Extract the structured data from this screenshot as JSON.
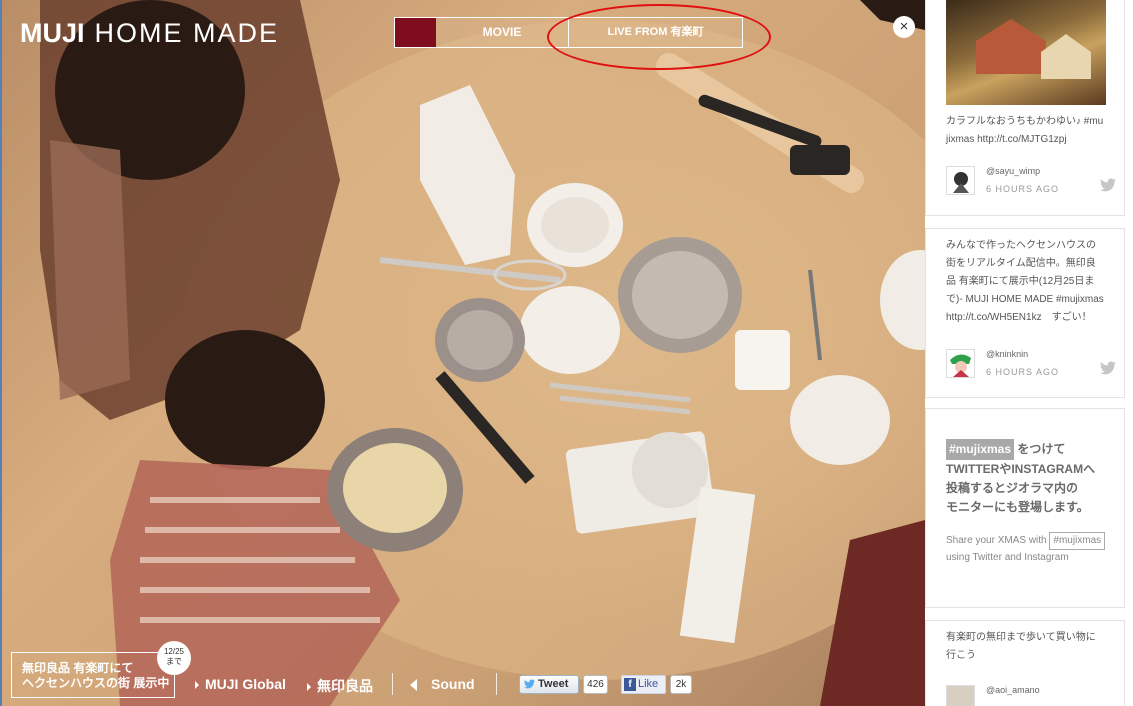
{
  "brand": {
    "logo_bold": "MUJI",
    "logo_thin": "HOME MADE"
  },
  "topnav": {
    "movie": "MOVIE",
    "live": "LIVE FROM 有楽町"
  },
  "close_label": "×",
  "sidebar": {
    "cards": [
      {
        "text": "カラフルなおうちもかわゆい♪ #mujixmas http://t.co/MJTG1zpj",
        "user": "@sayu_wimp",
        "time": "6 HOURS AGO"
      },
      {
        "text": "みんなで作ったヘクセンハウスの街をリアルタイム配信中。無印良品 有楽町にて展示中(12月25日まで)- MUJI HOME MADE #mujixmas http://t.co/WH5EN1kz　すごい！",
        "user": "@kninknin",
        "time": "6 HOURS AGO"
      },
      {
        "text": "有楽町の無印まで歩いて買い物に行こう",
        "user": "@aoi_amano",
        "time": ""
      }
    ],
    "promo": {
      "tag": "#mujixmas",
      "tag_suffix": "をつけて",
      "line2": "TWITTERやINSTAGRAMへ",
      "line3": "投稿するとジオラマ内の",
      "line4": "モニターにも登場します。",
      "small1": "Share your XMAS with",
      "small_tag": "#mujixmas",
      "small2": "using Twitter and Instagram"
    }
  },
  "bottom": {
    "exhibit_line1": "無印良品 有楽町にて",
    "exhibit_line2": "ヘクセンハウスの街 展示中",
    "date": "12/25",
    "date_sub": "まで",
    "link1": "MUJI Global",
    "link2": "無印良品",
    "sound": "Sound",
    "tweet": "Tweet",
    "tweet_count": "426",
    "like": "Like",
    "like_count": "2k"
  },
  "colors": {
    "accent": "#7e0d1e",
    "annotation": "#e01010",
    "twitter": "#55acee",
    "facebook": "#3b5998"
  }
}
